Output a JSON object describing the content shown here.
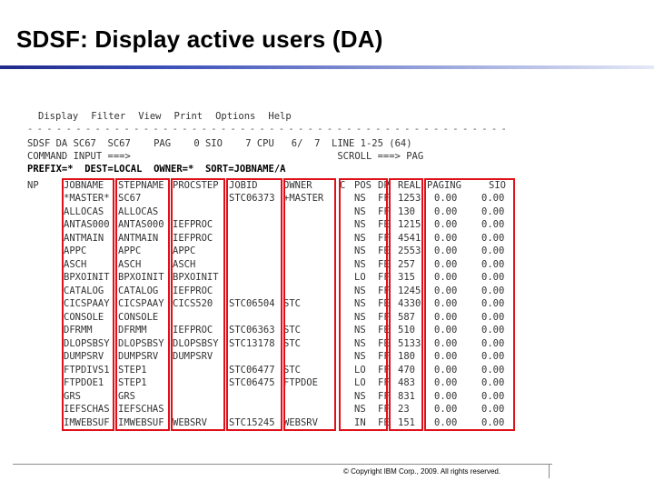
{
  "title": "SDSF: Display active users (DA)",
  "menu": [
    "Display",
    "Filter",
    "View",
    "Print",
    "Options",
    "Help"
  ],
  "dashes": "- - - - - - - - - - - - - - - - - - - - - - - - - - - - - - - - - - - - - - - - - - - - - - - - - - - - - - - - - - - - - - - - - - - - - - - - - -",
  "status_line": "SDSF DA SC67  SC67    PAG    0 SIO    7 CPU   6/  7  LINE 1-25 (64)",
  "command_line": "COMMAND INPUT ===>                                    SCROLL ===> PAG",
  "prefix_line": "PREFIX=*  DEST=LOCAL  OWNER=*  SORT=JOBNAME/A",
  "headers": [
    "NP",
    "JOBNAME",
    "STEPNAME",
    "PROCSTEP",
    "JOBID",
    "OWNER",
    "C",
    "POS",
    "DP",
    "REAL",
    "PAGING",
    "SIO"
  ],
  "rows": [
    [
      "*MASTER*",
      "SC67",
      "",
      "STC06373",
      "+MASTER",
      "NS",
      "FF",
      "1253",
      "0.00",
      "0.00"
    ],
    [
      "ALLOCAS",
      "ALLOCAS",
      "",
      "",
      "",
      "NS",
      "FF",
      "130",
      "0.00",
      "0.00"
    ],
    [
      "ANTAS000",
      "ANTAS000",
      "IEFPROC",
      "",
      "",
      "NS",
      "FE",
      "1215",
      "0.00",
      "0.00"
    ],
    [
      "ANTMAIN",
      "ANTMAIN",
      "IEFPROC",
      "",
      "",
      "NS",
      "FF",
      "4541",
      "0.00",
      "0.00"
    ],
    [
      "APPC",
      "APPC",
      "APPC",
      "",
      "",
      "NS",
      "FE",
      "2553",
      "0.00",
      "0.00"
    ],
    [
      "ASCH",
      "ASCH",
      "ASCH",
      "",
      "",
      "NS",
      "FE",
      "257",
      "0.00",
      "0.00"
    ],
    [
      "BPXOINIT",
      "BPXOINIT",
      "BPXOINIT",
      "",
      "",
      "LO",
      "FF",
      "315",
      "0.00",
      "0.00"
    ],
    [
      "CATALOG",
      "CATALOG",
      "IEFPROC",
      "",
      "",
      "NS",
      "FF",
      "1245",
      "0.00",
      "0.00"
    ],
    [
      "CICSPAAY",
      "CICSPAAY",
      "CICS520",
      "STC06504",
      "STC",
      "NS",
      "FE",
      "4330",
      "0.00",
      "0.00"
    ],
    [
      "CONSOLE",
      "CONSOLE",
      "",
      "",
      "",
      "NS",
      "FF",
      "587",
      "0.00",
      "0.00"
    ],
    [
      "DFRMM",
      "DFRMM",
      "IEFPROC",
      "STC06363",
      "STC",
      "NS",
      "FE",
      "510",
      "0.00",
      "0.00"
    ],
    [
      "DLOPSBSY",
      "DLOPSBSY",
      "DLOPSBSY",
      "STC13178",
      "STC",
      "NS",
      "FE",
      "5133",
      "0.00",
      "0.00"
    ],
    [
      "DUMPSRV",
      "DUMPSRV",
      "DUMPSRV",
      "",
      "",
      "NS",
      "FF",
      "180",
      "0.00",
      "0.00"
    ],
    [
      "FTPDIVS1",
      "STEP1",
      "",
      "STC06477",
      "STC",
      "LO",
      "FF",
      "470",
      "0.00",
      "0.00"
    ],
    [
      "FTPDOE1",
      "STEP1",
      "",
      "STC06475",
      "FTPDOE",
      "LO",
      "FF",
      "483",
      "0.00",
      "0.00"
    ],
    [
      "GRS",
      "GRS",
      "",
      "",
      "",
      "NS",
      "FF",
      "831",
      "0.00",
      "0.00"
    ],
    [
      "IEFSCHAS",
      "IEFSCHAS",
      "",
      "",
      "",
      "NS",
      "FF",
      "23",
      "0.00",
      "0.00"
    ],
    [
      "IMWEBSUF",
      "IMWEBSUF",
      "WEBSRV",
      "STC15245",
      "WEBSRV",
      "IN",
      "FE",
      "151",
      "0.00",
      "0.00"
    ]
  ],
  "copyright": "© Copyright IBM Corp., 2009. All rights reserved.",
  "colors": {
    "highlight_box": "#e0101a",
    "title_rule_dark": "#1f2a8a"
  }
}
